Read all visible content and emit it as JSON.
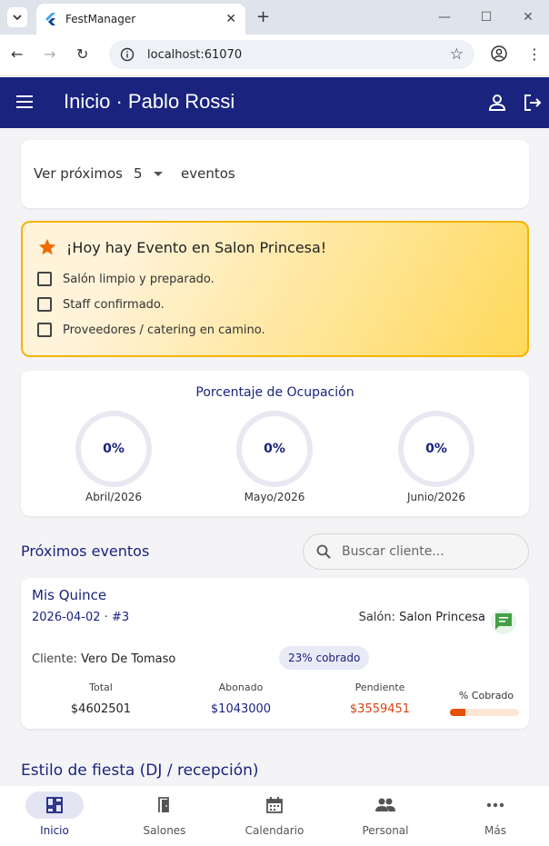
{
  "browser": {
    "tab_title": "FestManager",
    "url": "localhost:61070"
  },
  "app": {
    "title": "Inicio · Pablo Rossi"
  },
  "filter": {
    "prefix": "Ver próximos",
    "value": "5",
    "suffix": "eventos"
  },
  "today_event": {
    "title": "¡Hoy hay Evento en Salon Princesa!",
    "checklist": [
      "Salón limpio y preparado.",
      "Staff confirmado.",
      "Proveedores / catering en camino."
    ]
  },
  "occupancy": {
    "title": "Porcentaje de Ocupación",
    "months": [
      {
        "label": "Abril/2026",
        "percent": "0%"
      },
      {
        "label": "Mayo/2026",
        "percent": "0%"
      },
      {
        "label": "Junio/2026",
        "percent": "0%"
      }
    ]
  },
  "upcoming": {
    "title": "Próximos eventos",
    "search_placeholder": "Buscar cliente..."
  },
  "event": {
    "name": "Mis Quince",
    "date_id": "2026-04-02 · #3",
    "salon_label": "Salón:",
    "salon_name": "Salon Princesa",
    "client_label": "Cliente:",
    "client_name": "Vero De Tomaso",
    "badge": "23% cobrado",
    "total_label": "Total",
    "total_value": "$4602501",
    "paid_label": "Abonado",
    "paid_value": "$1043000",
    "pending_label": "Pendiente",
    "pending_value": "$3559451",
    "collected_label": "% Cobrado",
    "collected_fraction": 0.23
  },
  "next_section": {
    "title": "Estilo de fiesta (DJ / recepción)"
  },
  "bottom_nav": {
    "items": [
      "Inicio",
      "Salones",
      "Calendario",
      "Personal",
      "Más"
    ]
  },
  "colors": {
    "primary": "#1a237e",
    "accent": "#f5b400",
    "pending": "#d84315",
    "progress": "#e65100"
  }
}
